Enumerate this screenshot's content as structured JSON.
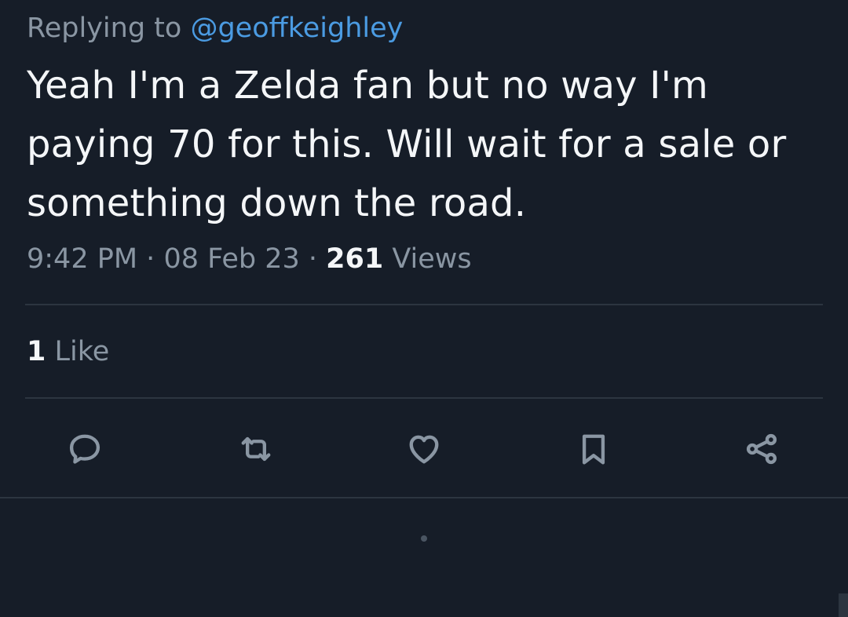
{
  "reply": {
    "prefix": "Replying to",
    "handle": "@geoffkeighley"
  },
  "tweet": {
    "text": "Yeah I'm a Zelda fan but no way I'm paying 70 for this. Will wait for a sale or something down the road."
  },
  "meta": {
    "time": "9:42 PM",
    "separator": "·",
    "date": "08 Feb 23",
    "views_count": "261",
    "views_label": "Views"
  },
  "engagement": {
    "like_count": "1",
    "like_label": "Like"
  },
  "actions": [
    {
      "icon": "reply-icon"
    },
    {
      "icon": "retweet-icon"
    },
    {
      "icon": "heart-icon"
    },
    {
      "icon": "bookmark-icon"
    },
    {
      "icon": "share-icon"
    }
  ],
  "colors": {
    "background": "#161d28",
    "text_primary": "#f4f6f8",
    "text_secondary": "#8a96a3",
    "link": "#4b9be2",
    "divider": "#2c3540"
  }
}
